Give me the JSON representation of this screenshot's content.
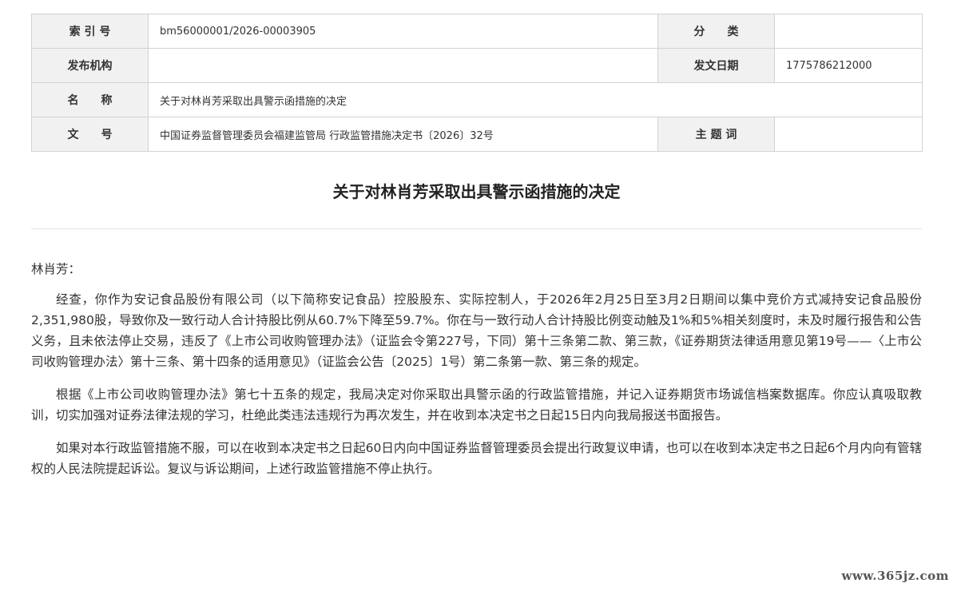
{
  "meta": {
    "index_label": "索 引 号",
    "index_value": "bm56000001/2026-00003905",
    "category_label": "分　　类",
    "category_value": "",
    "publisher_label": "发布机构",
    "publisher_value": "",
    "date_label": "发文日期",
    "date_value": "1775786212000",
    "name_label": "名　　称",
    "name_value": "关于对林肖芳采取出具警示函措施的决定",
    "docno_label": "文　　号",
    "docno_value": "中国证券监督管理委员会福建监管局 行政监管措施决定书〔2026〕32号",
    "keywords_label": "主 题 词",
    "keywords_value": ""
  },
  "document": {
    "title": "关于对林肖芳采取出具警示函措施的决定",
    "salutation": "林肖芳：",
    "paragraphs": [
      "经查，你作为安记食品股份有限公司（以下简称安记食品）控股股东、实际控制人，于2026年2月25日至3月2日期间以集中竞价方式减持安记食品股份2,351,980股，导致你及一致行动人合计持股比例从60.7%下降至59.7%。你在与一致行动人合计持股比例变动触及1%和5%相关刻度时，未及时履行报告和公告义务，且未依法停止交易，违反了《上市公司收购管理办法》（证监会令第227号，下同）第十三条第二款、第三款，《证券期货法律适用意见第19号——〈上市公司收购管理办法〉第十三条、第十四条的适用意见》（证监会公告〔2025〕1号）第二条第一款、第三条的规定。",
      "根据《上市公司收购管理办法》第七十五条的规定，我局决定对你采取出具警示函的行政监管措施，并记入证券期货市场诚信档案数据库。你应认真吸取教训，切实加强对证券法律法规的学习，杜绝此类违法违规行为再次发生，并在收到本决定书之日起15日内向我局报送书面报告。",
      "如果对本行政监管措施不服，可以在收到本决定书之日起60日内向中国证券监督管理委员会提出行政复议申请，也可以在收到本决定书之日起6个月内向有管辖权的人民法院提起诉讼。复议与诉讼期间，上述行政监管措施不停止执行。"
    ]
  },
  "watermark": "www.365jz.com"
}
